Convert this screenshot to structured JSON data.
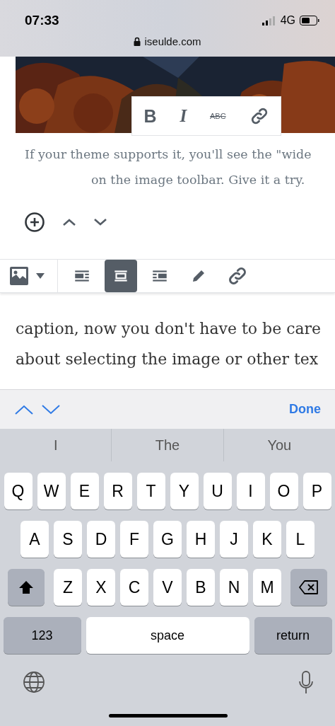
{
  "status_bar": {
    "time": "07:33",
    "network": "4G",
    "url": "iseulde.com"
  },
  "format_toolbar": [
    {
      "kind": "bold",
      "label": "B"
    },
    {
      "kind": "italic",
      "label": "I"
    },
    {
      "kind": "strike",
      "label": "ABC"
    },
    {
      "kind": "link"
    }
  ],
  "caption": [
    "If your theme supports it, you'll see the \"wide",
    "on the image toolbar. Give it a try."
  ],
  "block_mover": [
    {
      "kind": "add"
    },
    {
      "kind": "up"
    },
    {
      "kind": "down"
    }
  ],
  "image_toolbar": [
    {
      "kind": "align-left",
      "selected": false
    },
    {
      "kind": "align-center",
      "selected": true
    },
    {
      "kind": "align-right",
      "selected": false
    },
    {
      "kind": "edit",
      "selected": false
    },
    {
      "kind": "link",
      "selected": false
    }
  ],
  "paragraph": [
    "caption, now you don't have to be care",
    "about selecting the image or other tex"
  ],
  "keyboard_accessory": {
    "done": "Done"
  },
  "suggestions": [
    {
      "text": "I"
    },
    {
      "text": "The"
    },
    {
      "text": "You"
    }
  ],
  "keyboard": {
    "rows": [
      [
        "Q",
        "W",
        "E",
        "R",
        "T",
        "Y",
        "U",
        "I",
        "O",
        "P"
      ],
      [
        "A",
        "S",
        "D",
        "F",
        "G",
        "H",
        "J",
        "K",
        "L"
      ],
      [
        "Z",
        "X",
        "C",
        "V",
        "B",
        "N",
        "M"
      ]
    ],
    "numbers": "123",
    "space": "space",
    "return": "return"
  }
}
